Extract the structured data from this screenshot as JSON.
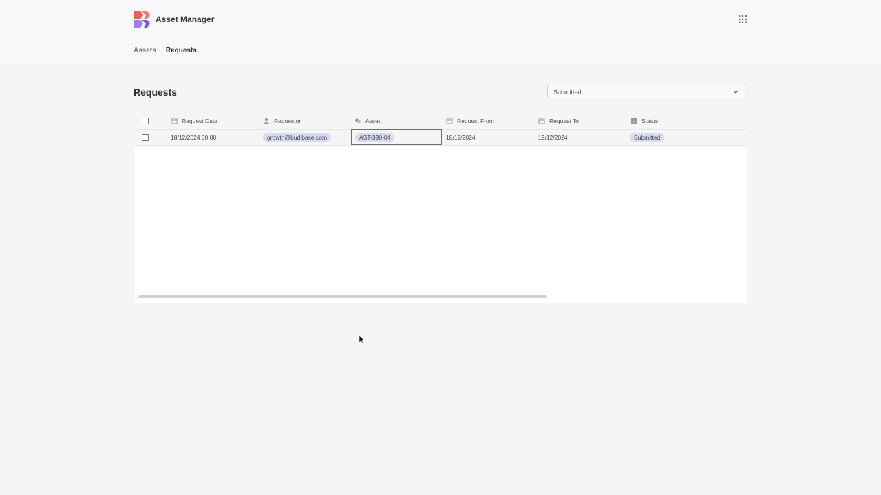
{
  "app": {
    "title": "Asset Manager",
    "logo_colors": [
      "#ef5b5b",
      "#8d63e8"
    ]
  },
  "nav": {
    "items": [
      {
        "label": "Assets",
        "active": false
      },
      {
        "label": "Requests",
        "active": true
      }
    ]
  },
  "page": {
    "title": "Requests"
  },
  "filter": {
    "selected": "Submitted"
  },
  "table": {
    "columns": [
      {
        "label": "Request Date",
        "icon": "calendar-icon"
      },
      {
        "label": "Requestor",
        "icon": "user-icon"
      },
      {
        "label": "Asset",
        "icon": "link-icon"
      },
      {
        "label": "Request From",
        "icon": "calendar-icon"
      },
      {
        "label": "Request To",
        "icon": "calendar-icon"
      },
      {
        "label": "Status",
        "icon": "list-icon"
      }
    ],
    "rows": [
      {
        "request_date": "18/12/2024 00:00",
        "requestor": "growth@budibase.com",
        "asset": "AST-390-04",
        "request_from": "18/12/2024",
        "request_to": "19/12/2024",
        "status": "Submitted"
      }
    ]
  },
  "colors": {
    "pill": "#d8dcef",
    "background": "#f5f5f5"
  }
}
